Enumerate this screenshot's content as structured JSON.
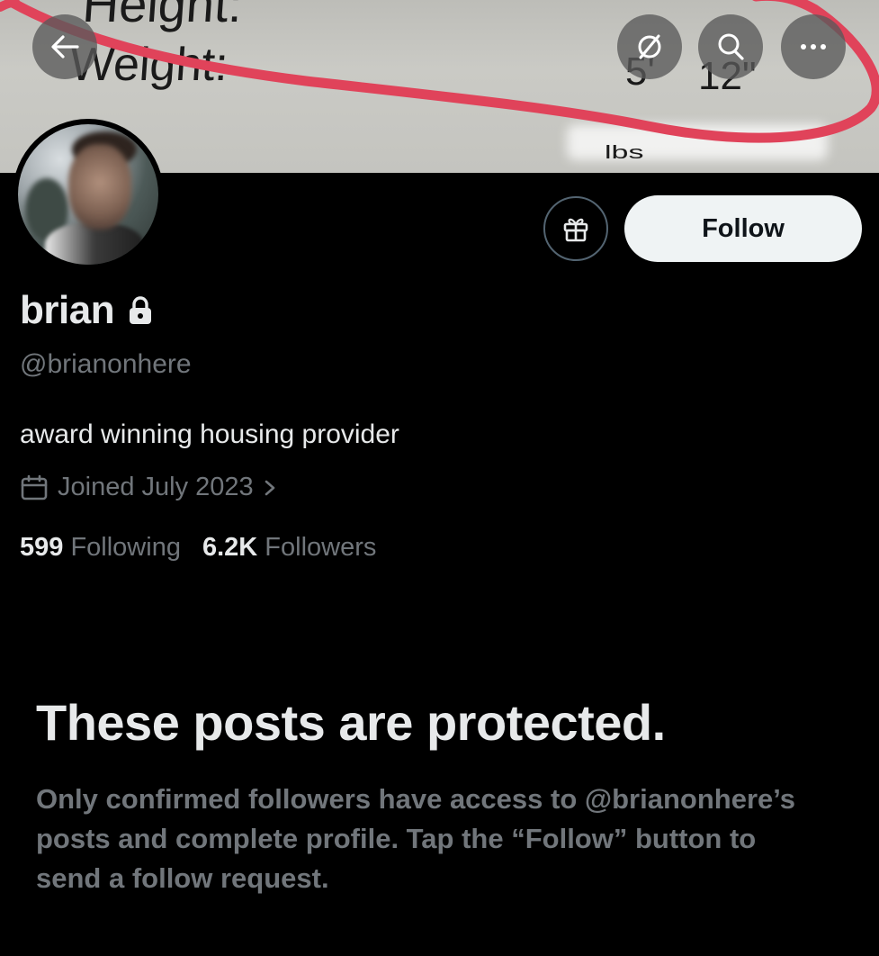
{
  "banner": {
    "label_top": "Height:",
    "label_weight": "Weight:",
    "height_feet": "5'",
    "height_inches": "12\"",
    "weight_partial": "lbs",
    "annotation_color": "#e0435a"
  },
  "top_bar": {
    "back_icon": "arrow-left-icon",
    "boost_icon": "circle-arrows-icon",
    "search_icon": "search-icon",
    "more_icon": "ellipsis-icon"
  },
  "profile": {
    "name": "brian",
    "handle": "@brianonhere",
    "bio": "award winning housing provider",
    "joined": "Joined July 2023",
    "following_count": "599",
    "following_label": "Following",
    "followers_count": "6.2K",
    "followers_label": "Followers",
    "follow_label": "Follow"
  },
  "protected": {
    "title": "These posts are protected.",
    "description": "Only confirmed followers have access to @brianonhere’s posts and complete profile. Tap the “Follow” button to send a follow request."
  },
  "colors": {
    "background": "#000000",
    "primary_text": "#e7e9ea",
    "secondary_text": "#71767b",
    "follow_button_bg": "#eff3f4"
  }
}
